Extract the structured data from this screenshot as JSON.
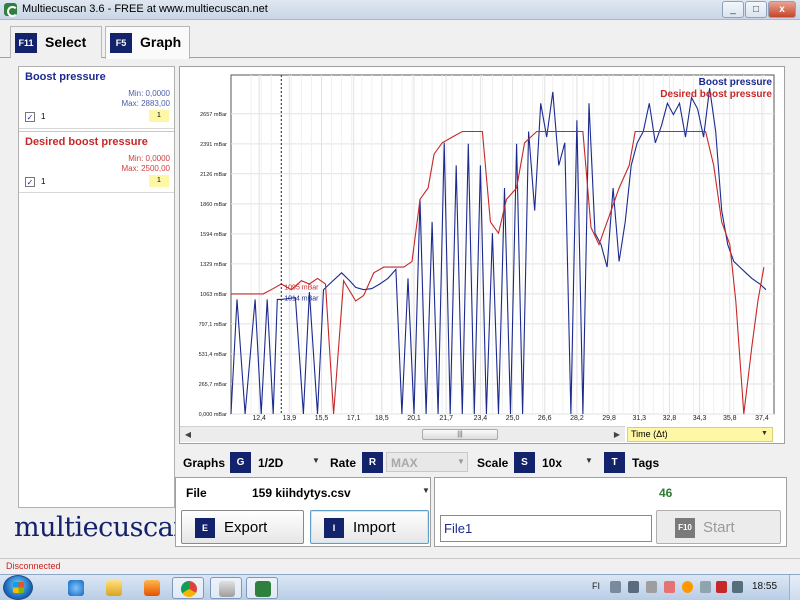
{
  "window": {
    "title": "Multiecuscan 3.6 - FREE at www.multiecuscan.net",
    "min": "_",
    "max": "□",
    "close": "x"
  },
  "tabs": [
    {
      "key": "F11",
      "label": "Select"
    },
    {
      "key": "F5",
      "label": "Graph"
    }
  ],
  "series": [
    {
      "name": "Boost pressure",
      "min": "Min: 0,0000",
      "max": "Max: 2883,00",
      "checked": "✓",
      "index": "1",
      "scale": "1",
      "color": "#1c2a8f"
    },
    {
      "name": "Desired boost pressure",
      "min": "Min: 0,0000",
      "max": "Max: 2500,00",
      "checked": "✓",
      "index": "1",
      "scale": "1",
      "color": "#c62828"
    }
  ],
  "logo": "multiecuscan",
  "chart_data": {
    "type": "line",
    "xlim": [
      11,
      38
    ],
    "ylim": [
      0,
      3000
    ],
    "x_ticks": [
      "12,4",
      "13,9",
      "15,5",
      "17,1",
      "18,5",
      "20,1",
      "21,7",
      "23,4",
      "25,0",
      "26,6",
      "28,2",
      "29,8",
      "31,3",
      "32,8",
      "34,3",
      "35,8",
      "37,4"
    ],
    "x_tick_values": [
      12.4,
      13.9,
      15.5,
      17.1,
      18.5,
      20.1,
      21.7,
      23.4,
      25.0,
      26.6,
      28.2,
      29.8,
      31.3,
      32.8,
      34.3,
      35.8,
      37.4
    ],
    "y_ticks": [
      "0,000 mBar",
      "265,7 mBar",
      "531,4 mBar",
      "797,1 mBar",
      "1063 mBar",
      "1329 mBar",
      "1594 mBar",
      "1860 mBar",
      "2126 mBar",
      "2391 mBar",
      "2657 mBar"
    ],
    "y_tick_values": [
      0,
      265.7,
      531.4,
      797.1,
      1063,
      1329,
      1594,
      1860,
      2126,
      2391,
      2657
    ],
    "cursor_x": 13.5,
    "cursor_labels": [
      "1095 mBar",
      "1014 mBar"
    ],
    "grid": true,
    "legend_position": "top-right",
    "series": [
      {
        "name": "Boost pressure",
        "color": "#1c2a8f",
        "x": [
          11.0,
          11.3,
          11.7,
          12.2,
          12.5,
          12.8,
          13.1,
          13.3,
          13.5,
          14.2,
          14.6,
          14.9,
          15.3,
          15.6,
          15.9,
          16.5,
          16.9,
          17.2,
          17.6,
          18.0,
          18.4,
          18.8,
          19.2,
          19.5,
          19.8,
          20.1,
          20.4,
          20.7,
          21.0,
          21.3,
          21.6,
          21.9,
          22.2,
          22.5,
          22.8,
          23.1,
          23.4,
          23.7,
          24.0,
          24.3,
          24.6,
          24.9,
          25.2,
          25.5,
          25.8,
          26.1,
          26.4,
          26.7,
          27.0,
          27.3,
          27.6,
          27.9,
          28.2,
          28.5,
          28.8,
          29.1,
          29.4,
          29.7,
          30.0,
          30.3,
          30.6,
          30.9,
          31.2,
          31.5,
          31.8,
          32.1,
          32.4,
          32.7,
          33.0,
          33.3,
          33.6,
          33.9,
          34.2,
          34.5,
          34.8,
          35.1,
          35.4,
          35.7,
          36.0,
          36.3,
          36.6,
          36.9,
          37.3,
          37.6
        ],
        "y": [
          0,
          1014,
          0,
          1014,
          0,
          1014,
          0,
          1014,
          1014,
          1030,
          0,
          1080,
          0,
          1100,
          1150,
          1250,
          1180,
          1120,
          1100,
          1110,
          1150,
          1200,
          1280,
          0,
          1200,
          0,
          1900,
          0,
          1700,
          0,
          2400,
          0,
          2200,
          0,
          2391,
          0,
          2200,
          0,
          1600,
          0,
          2000,
          0,
          2391,
          0,
          2500,
          1800,
          2750,
          2450,
          2850,
          2200,
          2400,
          0,
          2600,
          0,
          2750,
          1600,
          1500,
          1300,
          2000,
          1350,
          1700,
          2200,
          2400,
          2500,
          2750,
          2400,
          2550,
          2750,
          2650,
          2750,
          2450,
          2800,
          2700,
          2450,
          2883,
          2500,
          1800,
          1500,
          1350,
          1300,
          1250,
          1200,
          1150,
          1100
        ]
      },
      {
        "name": "Desired boost pressure",
        "color": "#c62828",
        "x": [
          11.0,
          12.0,
          12.6,
          13.0,
          13.5,
          14.0,
          14.5,
          14.9,
          15.3,
          15.7,
          16.1,
          16.6,
          17.2,
          17.6,
          18.1,
          18.6,
          19.1,
          19.6,
          20.0,
          20.4,
          20.8,
          21.1,
          21.5,
          22.0,
          22.5,
          23.0,
          23.5,
          23.9,
          24.3,
          24.7,
          25.2,
          25.6,
          26.2,
          27.0,
          27.8,
          28.5,
          28.9,
          29.3,
          29.8,
          30.3,
          30.8,
          31.1,
          31.5,
          32.0,
          33.0,
          34.0,
          34.6,
          35.0,
          35.4,
          35.8,
          36.1,
          36.5,
          36.9,
          37.2,
          37.5
        ],
        "y": [
          1063,
          1063,
          1063,
          1100,
          1150,
          1100,
          1180,
          1150,
          1200,
          1150,
          0,
          1180,
          1000,
          1050,
          1250,
          1300,
          1300,
          1300,
          1350,
          1900,
          2000,
          2300,
          2400,
          2450,
          2500,
          2500,
          2500,
          1700,
          1600,
          1900,
          2000,
          2400,
          2500,
          2500,
          2500,
          2500,
          1650,
          1500,
          1750,
          2000,
          2200,
          2500,
          2500,
          2500,
          2500,
          2500,
          2500,
          2200,
          1700,
          1500,
          1000,
          0,
          600,
          1000,
          1300
        ]
      }
    ]
  },
  "x_axis_select": "Time (Δt)",
  "scroll_thumb": "|||",
  "controls": {
    "graphs_label": "Graphs",
    "graphs_key": "G",
    "graphs_value": "1/2D",
    "rate_label": "Rate",
    "rate_key": "R",
    "rate_value": "MAX",
    "scale_label": "Scale",
    "scale_key": "S",
    "scale_value": "10x",
    "tags_key": "T",
    "tags_label": "Tags",
    "dd": "▼"
  },
  "file": {
    "label": "File",
    "value": "159  kiihdytys.csv",
    "export_key": "E",
    "export_label": "Export",
    "import_key": "I",
    "import_label": "Import"
  },
  "run": {
    "counter": "46",
    "name_value": "File1",
    "start_key": "F10",
    "start_label": "Start"
  },
  "status": "Disconnected",
  "taskbar": {
    "lang": "FI",
    "clock": "18:55"
  },
  "colors": {
    "accent_navy": "#12236b",
    "boost": "#1c2a8f",
    "desired": "#c62828",
    "yellow_field": "#fdf7a6"
  }
}
